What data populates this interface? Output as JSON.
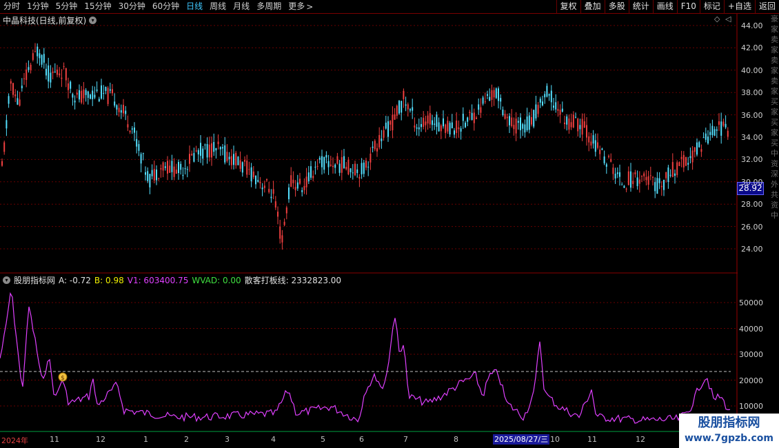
{
  "toolbar": {
    "tabs": [
      "分时",
      "1分钟",
      "5分钟",
      "15分钟",
      "30分钟",
      "60分钟",
      "日线",
      "周线",
      "月线",
      "多周期",
      "更多"
    ],
    "active_tab": "日线",
    "right_buttons": [
      "复权",
      "叠加",
      "多股",
      "统计",
      "画线",
      "F10",
      "标记",
      "+自选",
      "返回"
    ]
  },
  "price_panel": {
    "title": "中晶科技(日线,前复权)",
    "y_ticks": [
      "44.00",
      "42.00",
      "40.00",
      "38.00",
      "36.00",
      "34.00",
      "32.00",
      "30.00",
      "28.00",
      "26.00",
      "24.00"
    ],
    "current_price": "28.92",
    "up_color": "#f04040",
    "down_color": "#54e0ff"
  },
  "indicator_panel": {
    "name": "股朋指标网",
    "A": "A: -0.72",
    "B": "B: 0.98",
    "V1": "V1: 603400.75",
    "WVAD": "WVAD: 0.00",
    "sanke": "散客打板线: 2332823.00",
    "y_ticks": [
      "50000",
      "40000",
      "30000",
      "20000",
      "10000"
    ],
    "line_color": "#e040ff",
    "threshold_color": "#c0c0c0"
  },
  "x_axis": {
    "labels": [
      "2024年",
      "11",
      "12",
      "1",
      "2",
      "3",
      "4",
      "5",
      "6",
      "7",
      "8",
      "2025/08/27/三",
      "10",
      "11",
      "12"
    ]
  },
  "side_chars": [
    "豪",
    "家",
    "卖",
    "家",
    "卖",
    "家",
    "卖",
    "家",
    "买",
    "家",
    "买",
    "家",
    "买",
    "中",
    "资",
    "深",
    "外",
    "共",
    "资",
    "中"
  ],
  "watermark": {
    "line1": "股朋指标网",
    "line2": "www.7gpzb.com"
  }
}
